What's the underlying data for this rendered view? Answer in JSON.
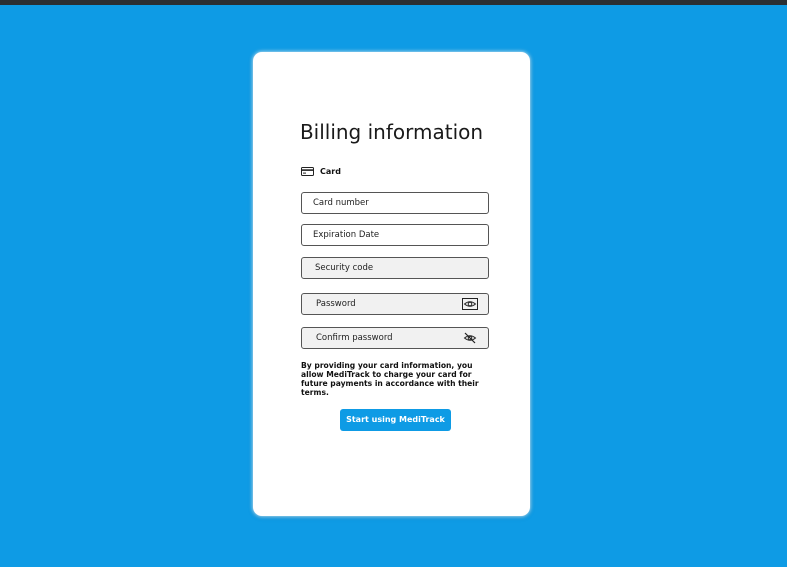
{
  "form": {
    "title": "Billing information",
    "section": {
      "label": "Card",
      "icon": "credit-card-icon"
    },
    "fields": [
      {
        "placeholder": "Card number",
        "state": "empty"
      },
      {
        "placeholder": "Expiration Date",
        "state": "empty"
      },
      {
        "placeholder": "Security code",
        "state": "filled"
      },
      {
        "placeholder": "Password",
        "state": "filled",
        "icon": "eye-icon"
      },
      {
        "placeholder": "Confirm password",
        "state": "filled",
        "icon": "eye-off-icon"
      }
    ],
    "notice": "By providing your card information, you allow MediTrack to charge your card for future payments in accordance with their terms.",
    "submit_label": "Start using MediTrack"
  },
  "colors": {
    "background": "#0e9be5",
    "accent": "#0e9be5",
    "card": "#ffffff",
    "field_filled": "#f1f1f1"
  }
}
